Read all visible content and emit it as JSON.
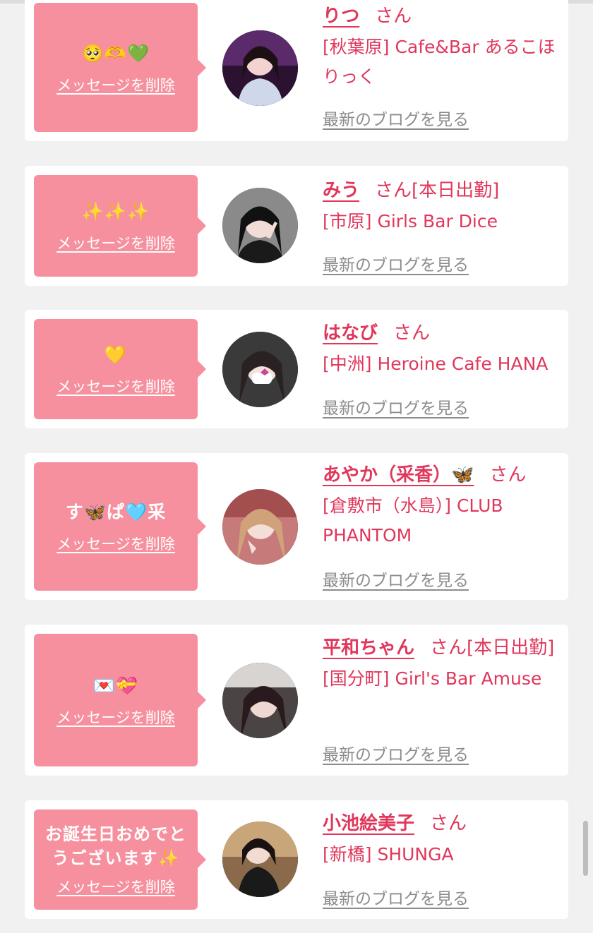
{
  "delete_label": "メッセージを削除",
  "blog_label": "最新のブログを見る",
  "san_label": "さん",
  "colors": {
    "accent": "#e0375b",
    "bubble": "#f7909e",
    "background": "#f1f1f1",
    "link_gray": "#8c8c8c"
  },
  "messages": [
    {
      "message": "🥺🫶💚",
      "name": "りつ",
      "status": "",
      "shop": "[秋葉原] Cafe&Bar あるこほりっく"
    },
    {
      "message": "✨✨✨",
      "name": "みう",
      "status": "[本日出勤]",
      "shop": "[市原] Girls Bar Dice"
    },
    {
      "message": "💛",
      "name": "はなび",
      "status": "",
      "shop": "[中洲] Heroine Cafe HANA"
    },
    {
      "message": "す🦋ぱ🩵采",
      "name": "あやか（采香）🦋",
      "status": "",
      "shop": "[倉敷市（水島）] CLUB PHANTOM"
    },
    {
      "message": "💌💝",
      "name": "平和ちゃん",
      "status": "[本日出勤]",
      "shop": "[国分町] Girl's Bar Amuse"
    },
    {
      "message": "お誕生日おめでとうございます✨",
      "name": "小池絵美子",
      "status": "",
      "shop": "[新橋] SHUNGA"
    }
  ]
}
